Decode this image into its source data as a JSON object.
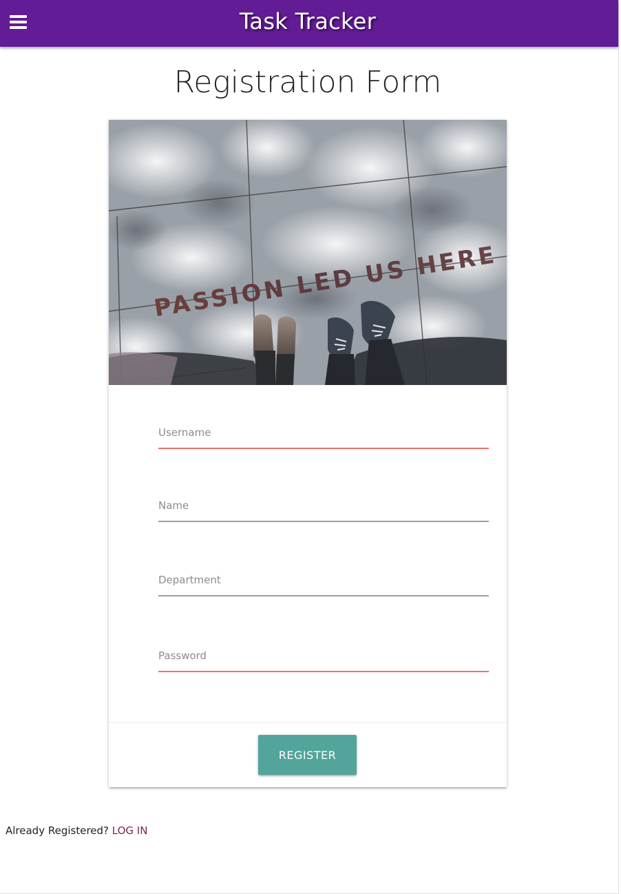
{
  "header": {
    "menu_icon": "hamburger-menu-icon",
    "title": "Task Tracker",
    "background_color": "#621c96"
  },
  "page": {
    "title": "Registration Form"
  },
  "card": {
    "image_text": "PASSION LED US HERE",
    "fields": [
      {
        "placeholder": "Username",
        "value": "",
        "state": "invalid"
      },
      {
        "placeholder": "Name",
        "value": "",
        "state": "default"
      },
      {
        "placeholder": "Department",
        "value": "",
        "state": "default"
      },
      {
        "placeholder": "Password",
        "value": "",
        "state": "invalid"
      }
    ],
    "register_label": "REGISTER",
    "register_color": "#53a59b",
    "invalid_color": "#e57368"
  },
  "footer": {
    "prompt": "Already Registered? ",
    "login_label": "LOG IN",
    "login_color": "#7b1f58"
  }
}
